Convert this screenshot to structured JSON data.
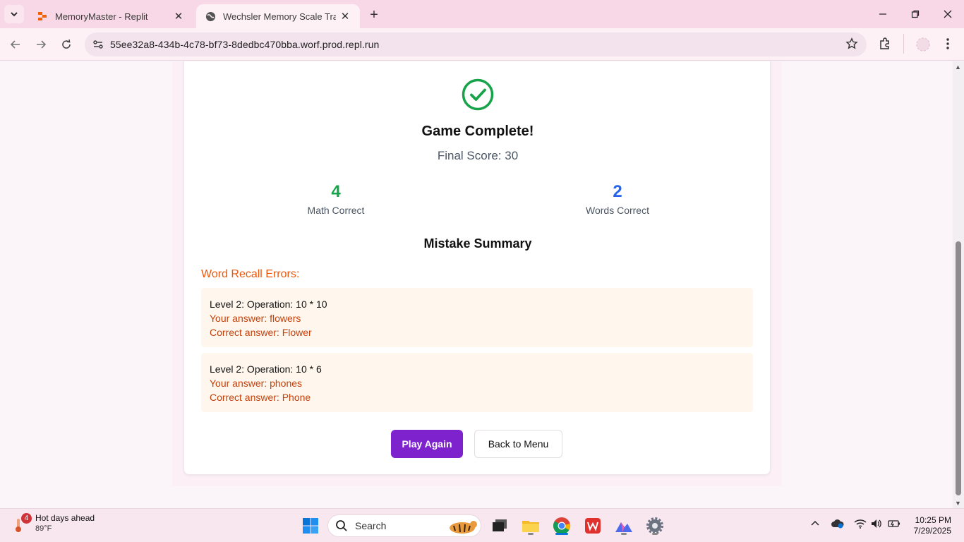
{
  "browser": {
    "tabs": [
      {
        "title": "MemoryMaster - Replit",
        "active": false
      },
      {
        "title": "Wechsler Memory Scale Training",
        "active": true
      }
    ],
    "url": "55ee32a8-434b-4c78-bf73-8dedbc470bba.worf.prod.repl.run"
  },
  "results": {
    "title": "Game Complete!",
    "final_score": "Final Score: 30",
    "math_correct_value": "4",
    "math_correct_label": "Math Correct",
    "words_correct_value": "2",
    "words_correct_label": "Words Correct"
  },
  "summary": {
    "title": "Mistake Summary",
    "word_errors_heading": "Word Recall Errors:",
    "errors": [
      {
        "operation": "Level 2: Operation: 10 * 10",
        "your_answer": "Your answer: flowers",
        "correct_answer": "Correct answer: Flower"
      },
      {
        "operation": "Level 2: Operation: 10 * 6",
        "your_answer": "Your answer: phones",
        "correct_answer": "Correct answer: Phone"
      }
    ]
  },
  "buttons": {
    "play_again": "Play Again",
    "back_to_menu": "Back to Menu"
  },
  "taskbar": {
    "weather_title": "Hot days ahead",
    "weather_temp": "89°F",
    "weather_badge": "4",
    "search_placeholder": "Search",
    "time": "10:25 PM",
    "date": "7/29/2025"
  },
  "colors": {
    "math_green": "#16a34a",
    "words_blue": "#2563eb",
    "error_orange": "#ea580c",
    "primary_purple": "#7e22ce"
  }
}
